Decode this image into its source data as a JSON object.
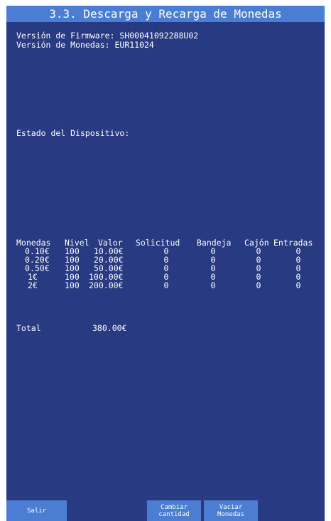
{
  "title": "3.3. Descarga y Recarga de Monedas",
  "firmware_line": "Versión de Firmware: SH00041092288U02",
  "coins_version_line": "Versión de Monedas: EUR11024",
  "device_status_line": "Estado del Dispositivo:",
  "table": {
    "headers": [
      "Monedas",
      "Nivel",
      "Valor",
      "Solicitud",
      "Bandeja",
      "Cajón",
      "Entradas"
    ],
    "rows": [
      {
        "coin": "0.10€",
        "level": "100",
        "value": "10.00€",
        "request": "0",
        "tray": "0",
        "drawer": "0",
        "inputs": "0"
      },
      {
        "coin": "0.20€",
        "level": "100",
        "value": "20.00€",
        "request": "0",
        "tray": "0",
        "drawer": "0",
        "inputs": "0"
      },
      {
        "coin": "0.50€",
        "level": "100",
        "value": "50.00€",
        "request": "0",
        "tray": "0",
        "drawer": "0",
        "inputs": "0"
      },
      {
        "coin": "1€",
        "level": "100",
        "value": "100.00€",
        "request": "0",
        "tray": "0",
        "drawer": "0",
        "inputs": "0"
      },
      {
        "coin": "2€",
        "level": "100",
        "value": "200.00€",
        "request": "0",
        "tray": "0",
        "drawer": "0",
        "inputs": "0"
      }
    ]
  },
  "total": {
    "label": "Total",
    "value": "380.00€"
  },
  "buttons": {
    "exit": "Salir",
    "change_qty_line1": "Cambiar",
    "change_qty_line2": "cantidad",
    "empty_line1": "Vaciar",
    "empty_line2": "Monedas"
  },
  "colors": {
    "background": "#283a82",
    "accent": "#4b7dd2",
    "text": "#ffffff"
  }
}
